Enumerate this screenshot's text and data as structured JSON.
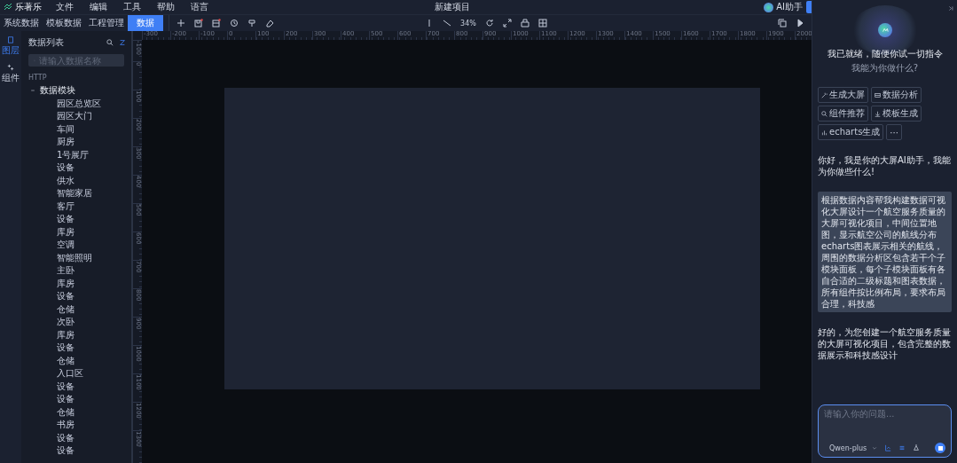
{
  "app": {
    "logo": "乐著乐",
    "menu": [
      "文件",
      "编辑",
      "工具",
      "帮助",
      "语言"
    ],
    "title": "新建项目",
    "assistant_button": "AI助手"
  },
  "tabs": [
    {
      "label": "系统数据",
      "selected": false
    },
    {
      "label": "模板数据",
      "selected": false
    },
    {
      "label": "工程管理",
      "selected": false
    },
    {
      "label": "数据",
      "selected": true
    }
  ],
  "rail": [
    {
      "label": "图层",
      "selected": true
    },
    {
      "label": "组件",
      "selected": false
    }
  ],
  "data_panel": {
    "title": "数据列表",
    "search": {
      "placeholder": "请输入数据名称"
    },
    "section": "HTTP",
    "tree": [
      {
        "label": "数据模块",
        "expanded": true,
        "children": [
          {
            "label": "园区总览区"
          },
          {
            "label": "园区大门"
          },
          {
            "label": "车间"
          },
          {
            "label": "厨房"
          },
          {
            "label": "1号展厅"
          },
          {
            "label": "设备"
          },
          {
            "label": "供水"
          },
          {
            "label": "智能家居"
          },
          {
            "label": "客厅"
          },
          {
            "label": "设备"
          },
          {
            "label": "库房"
          },
          {
            "label": "空调"
          },
          {
            "label": "智能照明"
          },
          {
            "label": "主卧"
          },
          {
            "label": "库房"
          },
          {
            "label": "设备"
          },
          {
            "label": "仓储"
          },
          {
            "label": "次卧"
          },
          {
            "label": "库房"
          },
          {
            "label": "设备"
          },
          {
            "label": "仓储"
          },
          {
            "label": "入口区"
          },
          {
            "label": "设备"
          },
          {
            "label": "设备"
          },
          {
            "label": "仓储"
          },
          {
            "label": "书房"
          },
          {
            "label": "设备"
          },
          {
            "label": "设备"
          }
        ]
      }
    ]
  },
  "toolbar": {
    "zoom": "34%"
  },
  "rulers": {
    "horizontal": [
      "-300",
      "-200",
      "-100",
      "0",
      "100",
      "200",
      "300",
      "400",
      "500",
      "600",
      "700",
      "800",
      "900",
      "1000",
      "1100",
      "1200",
      "1300",
      "1400",
      "1500",
      "1600",
      "1700",
      "1800",
      "1900",
      "2000"
    ],
    "vertical": [
      "-100",
      "0",
      "100",
      "200",
      "300",
      "400",
      "500",
      "600",
      "700",
      "800",
      "900",
      "1000",
      "1100",
      "1200",
      "1300"
    ]
  },
  "assistant": {
    "greeting": "我已就绪，随便你试一切指令",
    "subtitle": "我能为你做什么?",
    "quick_actions": [
      {
        "label": "生成大屏",
        "kind": "magic"
      },
      {
        "label": "数据分析",
        "kind": "table"
      },
      {
        "label": "组件推荐",
        "kind": "search"
      },
      {
        "label": "模板生成",
        "kind": "download"
      },
      {
        "label": "echarts生成",
        "kind": "chart"
      }
    ],
    "more": "···",
    "messages": [
      {
        "kind": "assistant",
        "text": "你好，我是你的大屏AI助手，我能为你做些什么!"
      },
      {
        "kind": "user",
        "text": "根据数据内容帮我构建数据可视化大屏设计一个航空服务质量的大屏可视化项目，中间位置地图，显示航空公司的航线分布echarts图表展示相关的航线，周围的数据分析区包含若干个子模块面板，每个子模块面板有各自合适的二级标题和图表数据，所有组件按比例布局，要求布局合理，科技感"
      },
      {
        "kind": "assistant",
        "text": "好的，为您创建一个航空服务质量的大屏可视化项目，包含完整的数据展示和科技感设计"
      }
    ],
    "input": {
      "placeholder": "请输入你的问题...",
      "model": "Qwen-plus"
    }
  }
}
